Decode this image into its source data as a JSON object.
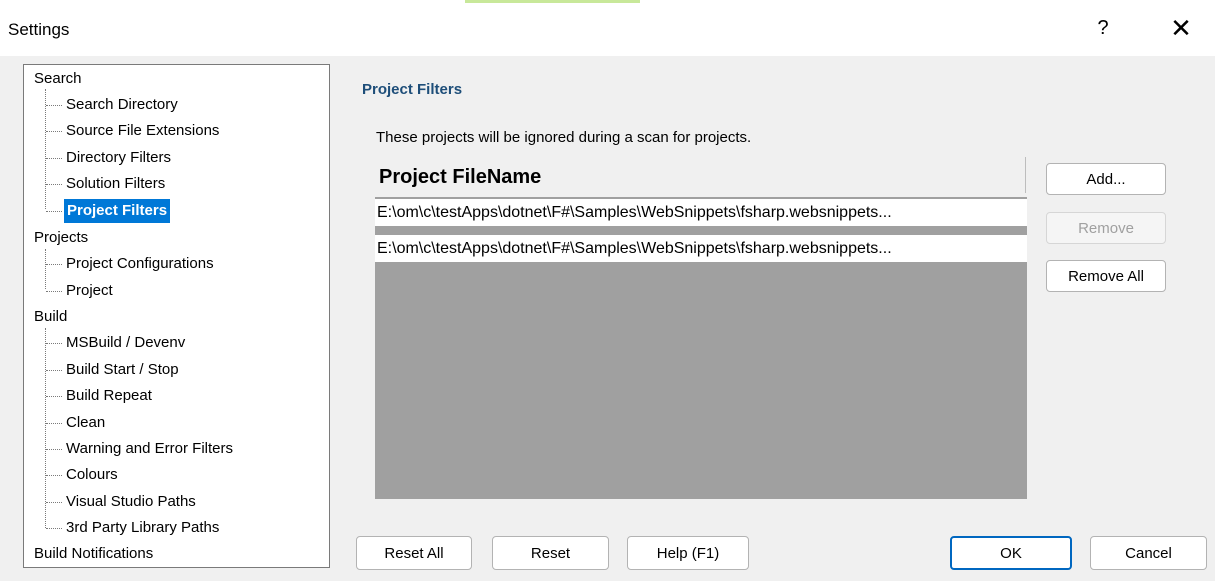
{
  "window": {
    "title": "Settings",
    "help_glyph": "?",
    "close_glyph": "✕"
  },
  "tree": {
    "groups": [
      {
        "label": "Search",
        "children": [
          "Search Directory",
          "Source File Extensions",
          "Directory Filters",
          "Solution Filters",
          "Project Filters"
        ]
      },
      {
        "label": "Projects",
        "children": [
          "Project Configurations",
          "Project"
        ]
      },
      {
        "label": "Build",
        "children": [
          "MSBuild / Devenv",
          "Build Start / Stop",
          "Build Repeat",
          "Clean",
          "Warning and Error Filters",
          "Colours",
          "Visual Studio Paths",
          "3rd Party Library Paths"
        ]
      },
      {
        "label": "Build Notifications",
        "children": []
      }
    ],
    "selected": "Project Filters"
  },
  "panel": {
    "title": "Project Filters",
    "description": "These projects will be ignored during a scan for projects.",
    "list": {
      "column_header": "Project FileName",
      "rows": [
        "E:\\om\\c\\testApps\\dotnet\\F#\\Samples\\WebSnippets\\fsharp.websnippets...",
        "E:\\om\\c\\testApps\\dotnet\\F#\\Samples\\WebSnippets\\fsharp.websnippets..."
      ]
    },
    "buttons": {
      "add": "Add...",
      "remove": "Remove",
      "remove_all": "Remove All"
    }
  },
  "footer": {
    "reset_all": "Reset All",
    "reset": "Reset",
    "help": "Help (F1)",
    "ok": "OK",
    "cancel": "Cancel"
  },
  "colors": {
    "selection": "#0078d7",
    "section_title": "#1e4e79",
    "list_background": "#a0a0a0",
    "ok_border": "#0067c0"
  }
}
